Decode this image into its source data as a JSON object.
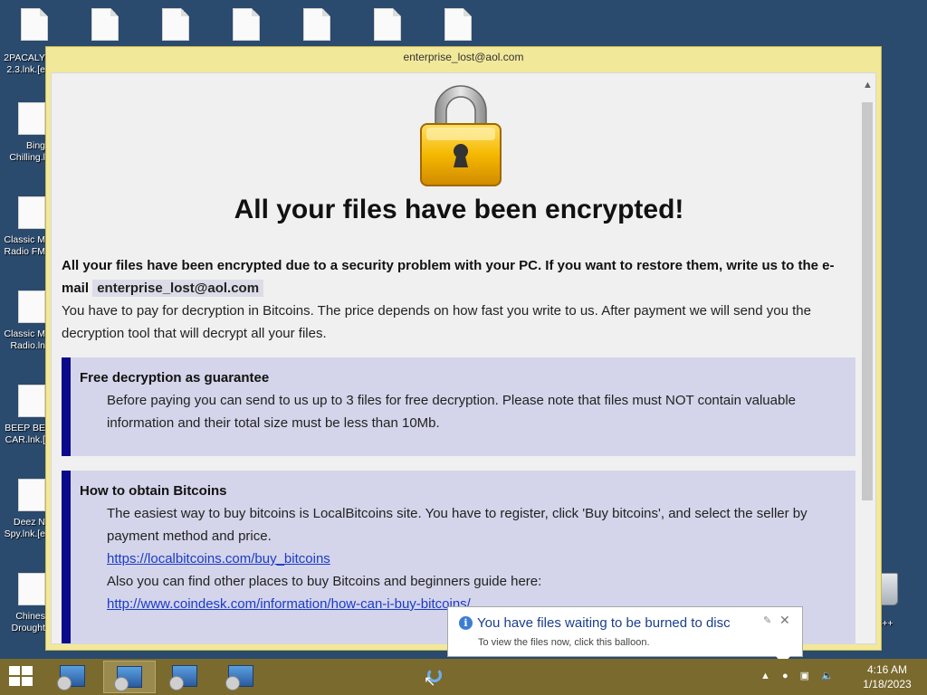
{
  "desktop": {
    "top_icons": [
      "",
      "",
      "",
      "",
      "",
      "",
      ""
    ],
    "left_icons": [
      {
        "line1": "2PACALY",
        "line2": "2.3.lnk.[e"
      },
      {
        "line1": "Bing",
        "line2": "Chilling.l"
      },
      {
        "line1": "Classic M",
        "line2": "Radio FM"
      },
      {
        "line1": "Classic M",
        "line2": "Radio.ln"
      },
      {
        "line1": "BEEP BE",
        "line2": "CAR.lnk.["
      },
      {
        "line1": "Deez N",
        "line2": "Spy.lnk.[e"
      },
      {
        "line1": "Chines",
        "line2": "Drought"
      }
    ],
    "right_label": "n C++"
  },
  "window": {
    "title": "enterprise_lost@aol.com",
    "headline": "All your files have been encrypted!",
    "intro_bold": "All your files have been encrypted due to a security problem with your PC. If you want to restore them, write us to the e-mail",
    "email": "enterprise_lost@aol.com",
    "intro_text": "You have to pay for decryption in Bitcoins. The price depends on how fast you write to us. After payment we will send you the decryption tool that will decrypt all your files.",
    "sections": [
      {
        "title": "Free decryption as guarantee",
        "body": "Before paying you can send to us up to 3 files for free decryption. Please note that files must NOT contain valuable information and their total size must be less than 10Mb."
      },
      {
        "title": "How to obtain Bitcoins",
        "body": "The easiest way to buy bitcoins is LocalBitcoins site. You have to register, click 'Buy bitcoins', and select the seller by payment method and price.",
        "link1": "https://localbitcoins.com/buy_bitcoins",
        "body2": "Also you can find other places to buy Bitcoins and beginners guide here:",
        "link2": "http://www.coindesk.com/information/how-can-i-buy-bitcoins/"
      }
    ]
  },
  "balloon": {
    "title": "You have files waiting to be burned to disc",
    "body": "To view the files now, click this balloon.",
    "info_icon": "i",
    "close": "✕"
  },
  "taskbar": {
    "time": "4:16 AM",
    "date": "1/18/2023",
    "buttons": [
      "installer",
      "installer",
      "installer",
      "installer"
    ]
  },
  "colors": {
    "window_frame": "#f2e89a",
    "section_bg": "#d4d4ea",
    "section_bar": "#0a0a8a",
    "link": "#1a3cc8"
  }
}
